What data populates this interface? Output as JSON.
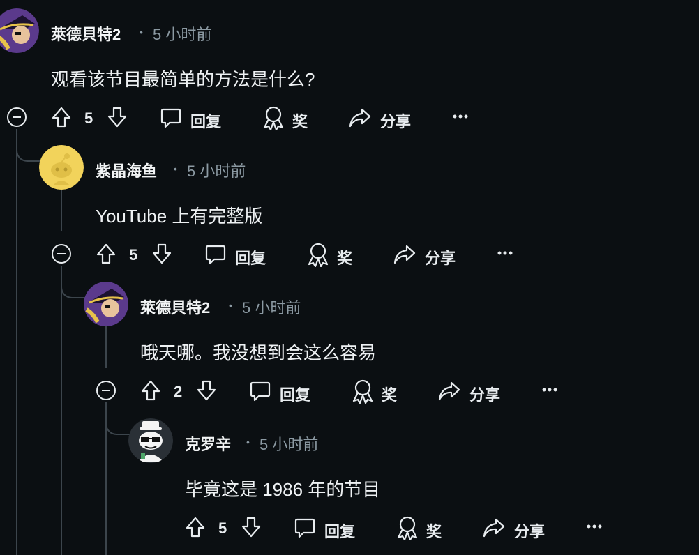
{
  "comments": [
    {
      "author": "萊德貝特2",
      "time": "5 小时前",
      "body": "观看该节目最简单的方法是什么?",
      "votes": "5",
      "avatar": "pirate-avatar"
    },
    {
      "author": "紫晶海鱼",
      "time": "5 小时前",
      "body": "YouTube 上有完整版",
      "votes": "5",
      "avatar": "yellow-snoo-avatar"
    },
    {
      "author": "萊德貝特2",
      "time": "5 小时前",
      "body": "哦天哪。我没想到会这么容易",
      "votes": "2",
      "avatar": "pirate-avatar"
    },
    {
      "author": "克罗辛",
      "time": "5 小时前",
      "body": "毕竟这是 1986 年的节目",
      "votes": "5",
      "avatar": "snoo-sunglasses-avatar"
    }
  ],
  "actions": {
    "reply": "回复",
    "award": "奖",
    "share": "分享"
  },
  "meta_separator": "•",
  "colors": {
    "background": "#0b0f12",
    "thread_line": "#3c454c",
    "muted_text": "#8c9aa3",
    "avatar_purple": "#5b3a8c",
    "avatar_yellow": "#f2d35b"
  }
}
